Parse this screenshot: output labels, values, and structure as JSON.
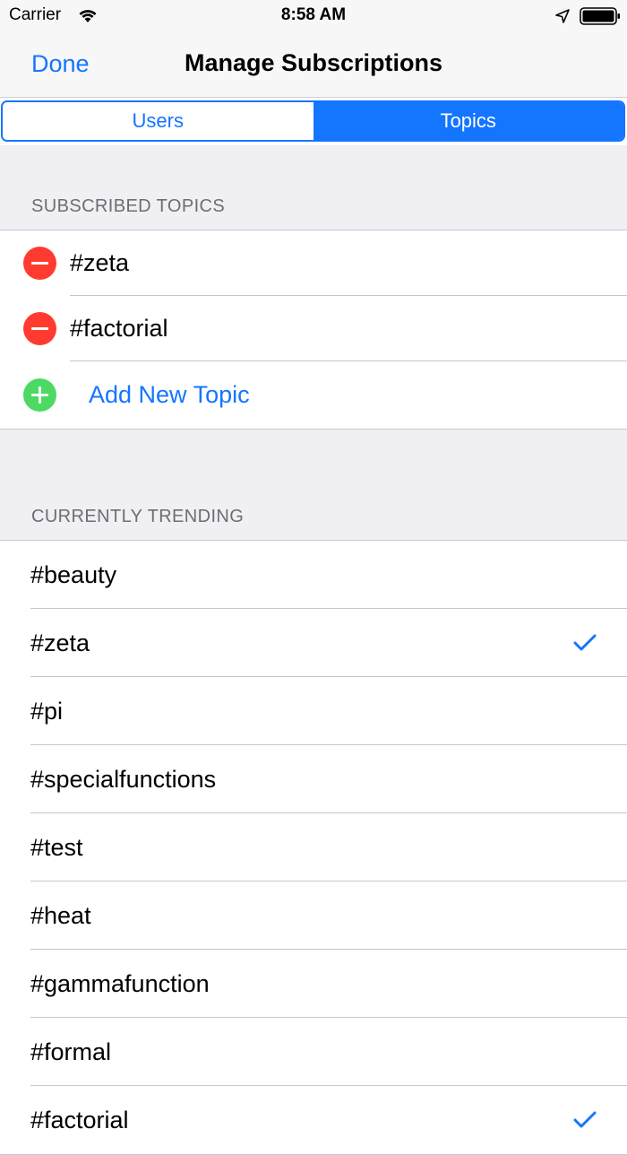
{
  "status_bar": {
    "carrier": "Carrier",
    "time": "8:58 AM",
    "icons": [
      "wifi-icon",
      "location-arrow-icon",
      "battery-icon"
    ]
  },
  "nav": {
    "done_label": "Done",
    "title": "Manage Subscriptions"
  },
  "segments": {
    "users": "Users",
    "topics": "Topics",
    "selected": "Topics"
  },
  "subscribed": {
    "header": "SUBSCRIBED TOPICS",
    "items": [
      "#zeta",
      "#factorial"
    ],
    "add_label": "Add New Topic"
  },
  "trending": {
    "header": "CURRENTLY TRENDING",
    "items": [
      {
        "label": "#beauty",
        "checked": false
      },
      {
        "label": "#zeta",
        "checked": true
      },
      {
        "label": "#pi",
        "checked": false
      },
      {
        "label": "#specialfunctions",
        "checked": false
      },
      {
        "label": "#test",
        "checked": false
      },
      {
        "label": "#heat",
        "checked": false
      },
      {
        "label": "#gammafunction",
        "checked": false
      },
      {
        "label": "#formal",
        "checked": false
      },
      {
        "label": "#factorial",
        "checked": true
      }
    ]
  },
  "colors": {
    "accent": "#1475ff",
    "delete": "#ff3b30",
    "add": "#4cd964",
    "grouped_background": "#efeff4"
  }
}
